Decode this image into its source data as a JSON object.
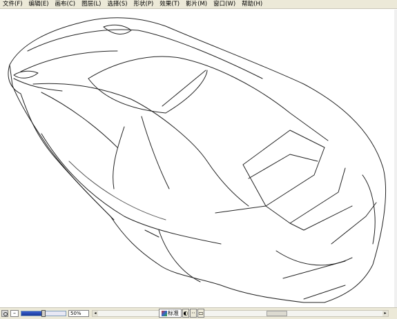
{
  "menu": {
    "items": [
      {
        "label": "文件(F)"
      },
      {
        "label": "编辑(E)"
      },
      {
        "label": "画布(C)"
      },
      {
        "label": "图层(L)"
      },
      {
        "label": "选择(S)"
      },
      {
        "label": "形状(P)"
      },
      {
        "label": "效果(T)"
      },
      {
        "label": "影片(M)"
      },
      {
        "label": "窗口(W)"
      },
      {
        "label": "帮助(H)"
      }
    ]
  },
  "canvas": {
    "subject": "car-line-drawing"
  },
  "status": {
    "zoom_value": "50%",
    "zoom_level": 0.5,
    "mode_label": "标准",
    "mode_icons": [
      "color-palette-icon",
      "moon-icon",
      "dots-icon",
      "fullscreen-icon"
    ]
  }
}
